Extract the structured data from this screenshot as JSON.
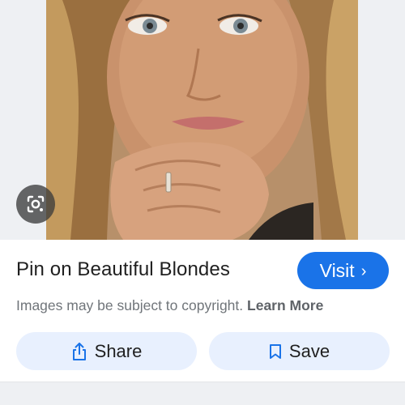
{
  "result": {
    "title": "Pin on Beautiful Blondes",
    "visit_label": "Visit",
    "visit_chevron": "›",
    "copyright_text": "Images may be subject to copyright.",
    "learn_more_label": "Learn More"
  },
  "actions": {
    "share_label": "Share",
    "save_label": "Save"
  },
  "icons": {
    "lens": "google-lens-icon",
    "share": "share-icon",
    "save": "bookmark-icon"
  },
  "colors": {
    "accent": "#1a73e8",
    "action_bg": "#e8f0fe",
    "muted_text": "#70757a"
  }
}
